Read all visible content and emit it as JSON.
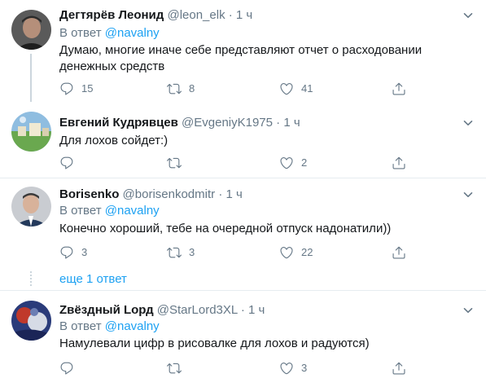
{
  "icons": {
    "reply": "reply-icon",
    "retweet": "retweet-icon",
    "like": "like-icon",
    "share": "share-icon",
    "caret": "chevron-down-icon"
  },
  "colors": {
    "accent": "#1da1f2",
    "secondary_text": "#657786",
    "primary_text": "#14171a",
    "divider": "#e6ecf0"
  },
  "tweets": [
    {
      "name": "Дегтярёв Леонид",
      "handle": "@leon_elk",
      "dot": "·",
      "time": "1 ч",
      "reply_prefix": "В ответ",
      "reply_mention": "@navalny",
      "text": "Думаю, многие иначе себе представляют отчет о расходовании денежных средств",
      "replies": "15",
      "retweets": "8",
      "likes": "41"
    },
    {
      "name": "Евгений Кудрявцев",
      "handle": "@EvgeniyK1975",
      "dot": "·",
      "time": "1 ч",
      "text": "Для лохов сойдет:)",
      "replies": "",
      "retweets": "",
      "likes": "2"
    },
    {
      "name": "Borisenko",
      "handle": "@borisenkodmitr",
      "dot": "·",
      "time": "1 ч",
      "reply_prefix": "В ответ",
      "reply_mention": "@navalny",
      "text": "Конечно хороший, тебе на очередной отпуск надонатили))",
      "replies": "3",
      "retweets": "3",
      "likes": "22"
    },
    {
      "name": "Zвёздный Lорд",
      "handle": "@StarLord3XL",
      "dot": "·",
      "time": "1 ч",
      "reply_prefix": "В ответ",
      "reply_mention": "@navalny",
      "text": "Намулевали цифр в рисовалке для лохов и радуются)",
      "replies": "",
      "retweets": "",
      "likes": "3"
    }
  ],
  "show_more": "еще 1 ответ"
}
